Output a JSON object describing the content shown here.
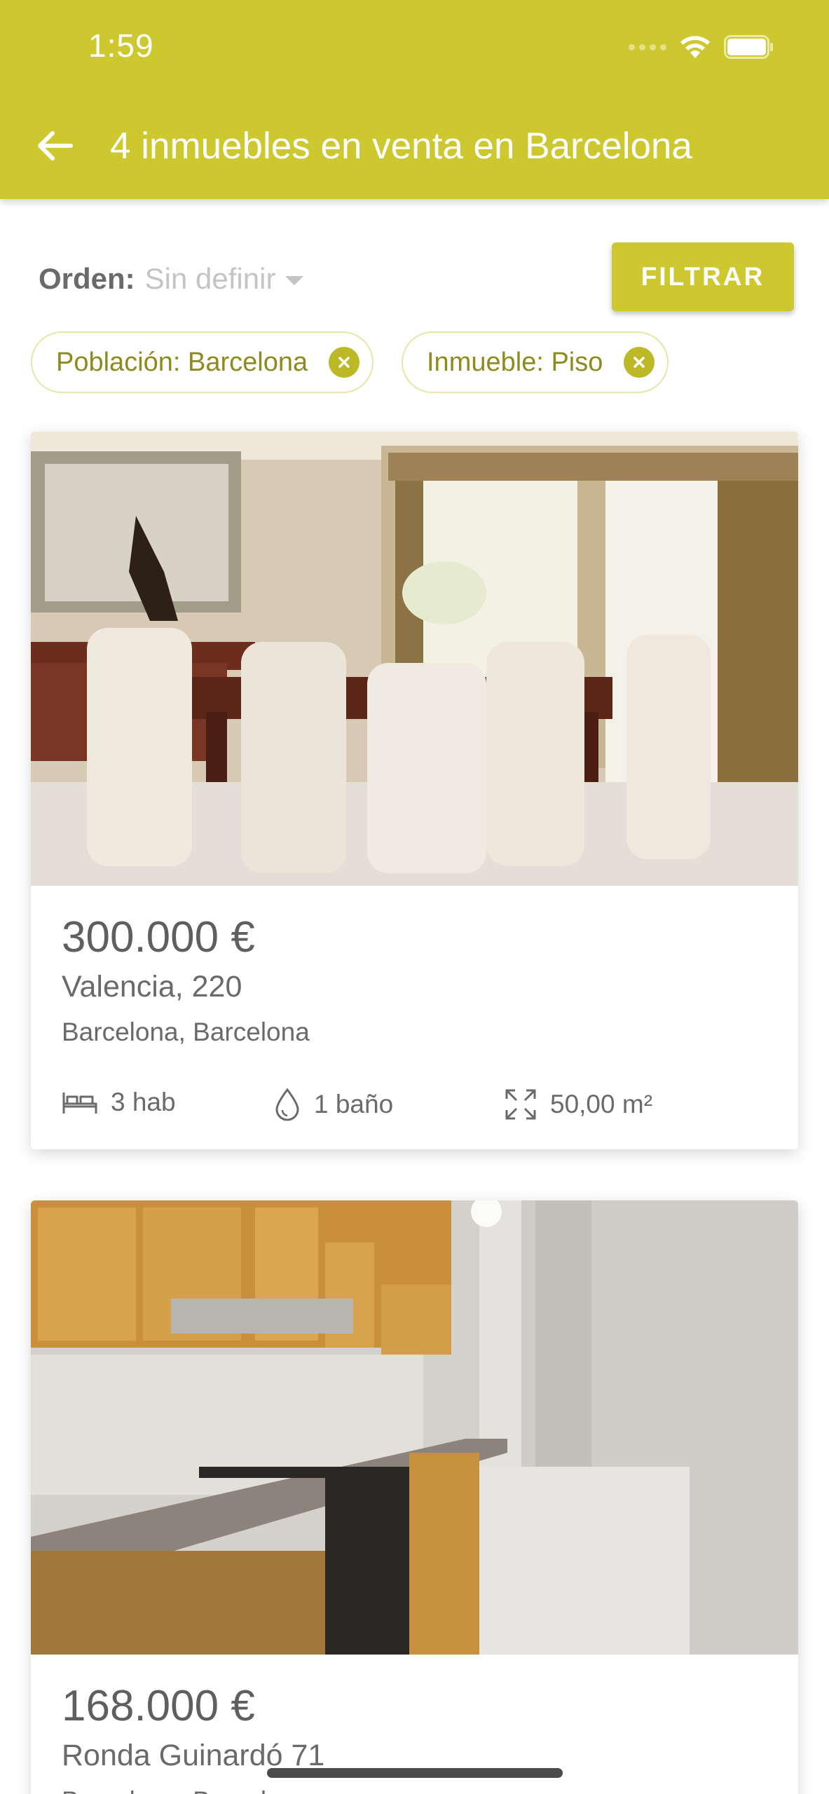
{
  "status_bar": {
    "time": "1:59"
  },
  "header": {
    "title": "4 inmuebles en venta en Barcelona",
    "background_color": "#cdc82f"
  },
  "sort": {
    "label": "Orden:",
    "value": "Sin definir"
  },
  "filter_button": {
    "label": "FILTRAR"
  },
  "filters": [
    {
      "label": "Población: Barcelona"
    },
    {
      "label": "Inmueble: Piso"
    }
  ],
  "listings": [
    {
      "price": "300.000 €",
      "street": "Valencia, 220",
      "city": "Barcelona, Barcelona",
      "rooms": "3 hab",
      "baths": "1 baño",
      "area": "50,00 m²"
    },
    {
      "price": "168.000 €",
      "street": "Ronda Guinardó 71",
      "city": "Barcelona, Barcelona"
    }
  ]
}
